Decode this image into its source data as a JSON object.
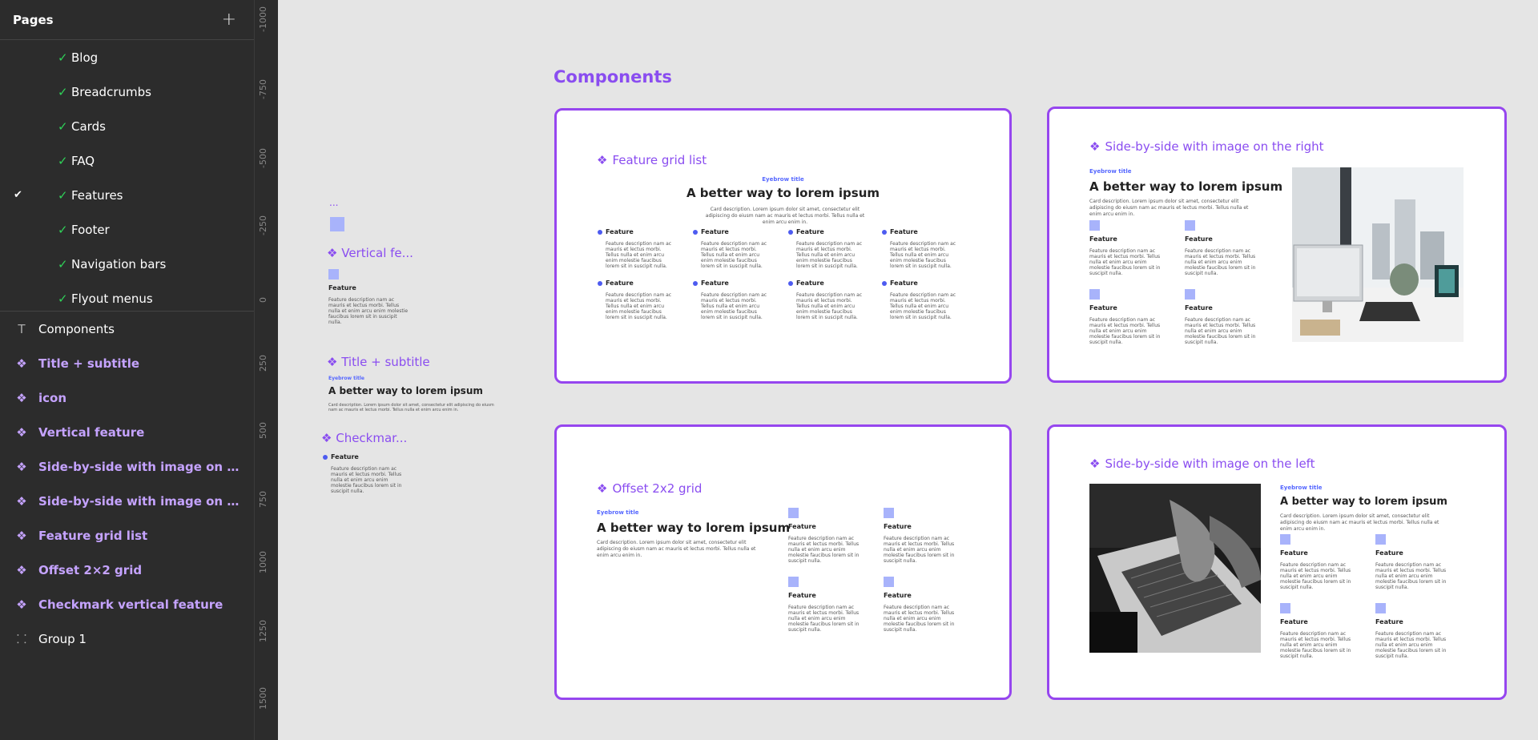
{
  "sidebar": {
    "title": "Pages",
    "add_icon": "+",
    "pages": [
      {
        "label": "Blog"
      },
      {
        "label": "Breadcrumbs"
      },
      {
        "label": "Cards"
      },
      {
        "label": "FAQ"
      },
      {
        "label": "Features",
        "selected": true
      },
      {
        "label": "Footer"
      },
      {
        "label": "Navigation bars"
      },
      {
        "label": "Flyout menus"
      }
    ],
    "layers": [
      {
        "label": "Components",
        "icon": "T",
        "kind": "plain"
      },
      {
        "label": "Title + subtitle",
        "icon": "❖",
        "kind": "comp"
      },
      {
        "label": "icon",
        "icon": "❖",
        "kind": "comp"
      },
      {
        "label": "Vertical feature",
        "icon": "❖",
        "kind": "comp"
      },
      {
        "label": "Side-by-side with image on the left",
        "icon": "❖",
        "kind": "comp"
      },
      {
        "label": "Side-by-side with image on the ri...",
        "icon": "❖",
        "kind": "comp"
      },
      {
        "label": "Feature grid list",
        "icon": "❖",
        "kind": "comp"
      },
      {
        "label": "Offset 2×2 grid",
        "icon": "❖",
        "kind": "comp"
      },
      {
        "label": "Checkmark vertical feature",
        "icon": "❖",
        "kind": "comp"
      },
      {
        "label": "Group 1",
        "icon": "⸬",
        "kind": "plain"
      }
    ]
  },
  "ruler": {
    "ticks": [
      "-1000",
      "-750",
      "-500",
      "-250",
      "0",
      "250",
      "500",
      "750",
      "1000",
      "1250",
      "1500"
    ]
  },
  "canvas": {
    "title": "Components",
    "loose": {
      "dots": "...",
      "vertical_title": "Vertical fe...",
      "vertical_feature_name": "Feature",
      "vertical_feature_desc": "Feature description nam ac mauris et lectus morbi. Tellus nulla et enim arcu enim molestie faucibus lorem sit in suscipit nulla.",
      "title_subtitle_title": "Title + subtitle",
      "ts_eyebrow": "Eyebrow title",
      "ts_headline": "A better way to lorem ipsum",
      "ts_desc": "Card description. Lorem ipsum dolor sit amet, consectetur elit adipiscing do eiusm nam ac mauris et lectus morbi. Tellus nulla et enim arcu enim in.",
      "checkmark_title": "Checkmar...",
      "checkmark_feature_name": "Feature",
      "checkmark_feature_desc": "Feature description nam ac mauris et lectus morbi. Tellus nulla et enim arcu enim molestie faucibus lorem sit in suscipit nulla."
    },
    "frames": {
      "grid": {
        "title": "Feature grid list",
        "eyebrow": "Eyebrow title",
        "headline": "A better way to lorem ipsum",
        "desc": "Card description. Lorem ipsum dolor sit amet, consectetur elit adipiscing do eiusm nam ac mauris et lectus morbi. Tellus nulla et enim arcu enim in.",
        "feature_name": "Feature",
        "feature_desc": "Feature description nam ac mauris et lectus morbi. Tellus nulla et enim arcu enim molestie faucibus lorem sit in suscipit nulla."
      },
      "right": {
        "title": "Side-by-side with image on the right",
        "eyebrow": "Eyebrow title",
        "headline": "A better way to lorem ipsum",
        "desc": "Card description. Lorem ipsum dolor sit amet, consectetur elit adipiscing do eiusm nam ac mauris et lectus morbi. Tellus nulla et enim arcu enim in.",
        "feature_name": "Feature",
        "feature_desc": "Feature description nam ac mauris et lectus morbi. Tellus nulla et enim arcu enim molestie faucibus lorem sit in suscipit nulla."
      },
      "offset": {
        "title": "Offset 2x2 grid",
        "eyebrow": "Eyebrow title",
        "headline": "A better way to lorem ipsum",
        "desc": "Card description. Lorem ipsum dolor sit amet, consectetur elit adipiscing do eiusm nam ac mauris et lectus morbi. Tellus nulla et enim arcu enim in.",
        "feature_name": "Feature",
        "feature_desc": "Feature description nam ac mauris et lectus morbi. Tellus nulla et enim arcu enim molestie faucibus lorem sit in suscipit nulla."
      },
      "left": {
        "title": "Side-by-side with image on the left",
        "eyebrow": "Eyebrow title",
        "headline": "A better way to lorem ipsum",
        "desc": "Card description. Lorem ipsum dolor sit amet, consectetur elit adipiscing do eiusm nam ac mauris et lectus morbi. Tellus nulla et enim arcu enim in.",
        "feature_name": "Feature",
        "feature_desc": "Feature description nam ac mauris et lectus morbi. Tellus nulla et enim arcu enim molestie faucibus lorem sit in suscipit nulla."
      }
    }
  },
  "colors": {
    "sidebar_bg": "#2c2c2c",
    "canvas_bg": "#e5e5e5",
    "component_purple": "#9646ef",
    "component_label": "#c5a3ff",
    "check_green": "#2fd158",
    "feature_square": "#a8b3fb",
    "eyebrow_blue": "#5567ff"
  }
}
